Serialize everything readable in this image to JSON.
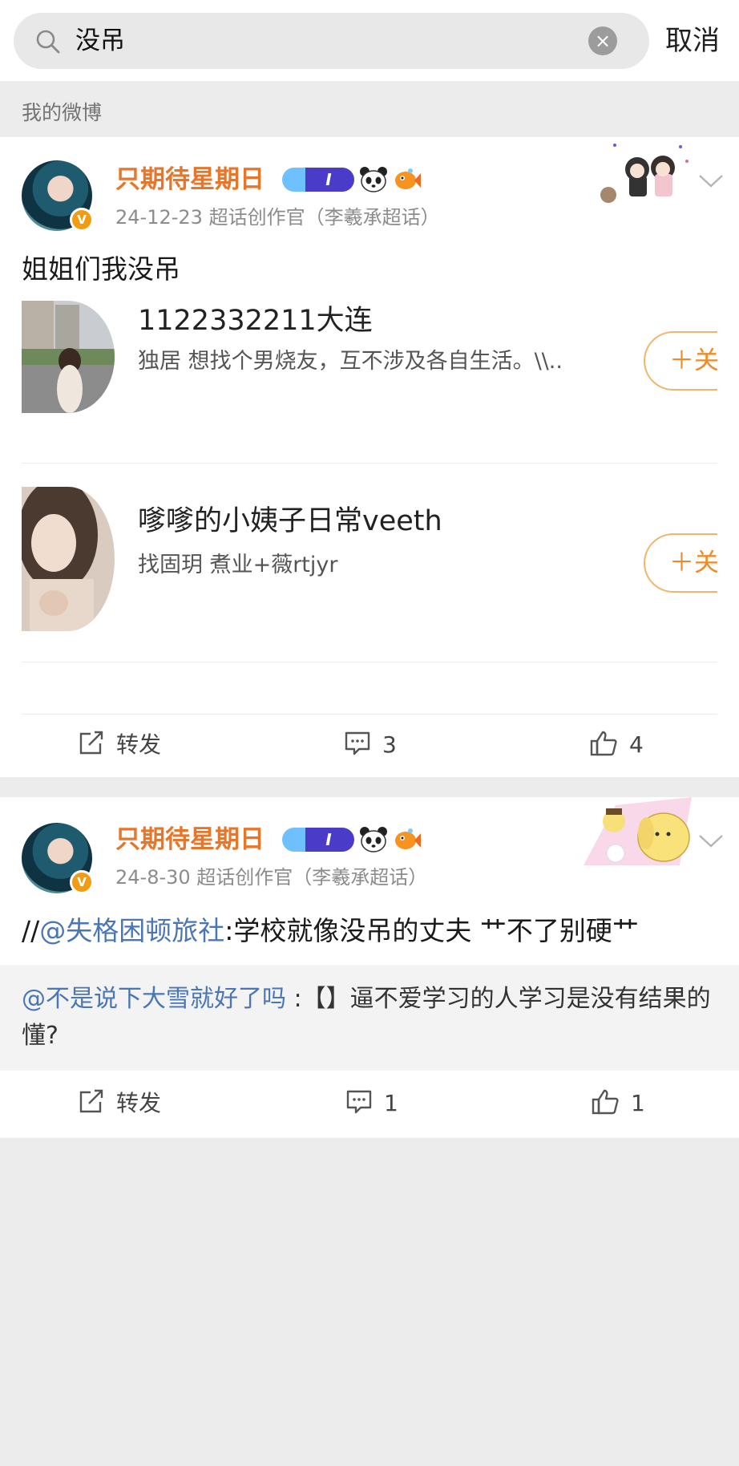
{
  "search": {
    "query": "没吊",
    "cancel_label": "取消"
  },
  "section_title": "我的微博",
  "posts": [
    {
      "username": "只期待星期日",
      "level_badge": "I",
      "meta": "24-12-23   超话创作官（李羲承超话）",
      "text": "姐姐们我没吊",
      "recommendations": [
        {
          "name": "1122332211大连",
          "desc": "独居 想找个男烧友，互不涉及各自生活。\\\\..",
          "follow_label": "＋关"
        },
        {
          "name": "嗲嗲的小姨子日常veeth",
          "desc": "找固玥 煮业+薇rtjyr",
          "follow_label": "＋关"
        }
      ],
      "actions": {
        "repost_label": "转发",
        "comment_count": "3",
        "like_count": "4"
      }
    },
    {
      "username": "只期待星期日",
      "level_badge": "I",
      "meta": "24-8-30   超话创作官（李羲承超话）",
      "text_prefix": "//",
      "mention": "@失格困顿旅社",
      "text_body": ":学校就像没吊的丈夫 艹不了别硬艹",
      "quote_mention": "@不是说下大雪就好了吗",
      "quote_text": " :【】逼不爱学习的人学习是没有结果的 懂?",
      "actions": {
        "repost_label": "转发",
        "comment_count": "1",
        "like_count": "1"
      }
    }
  ],
  "colors": {
    "accent_orange": "#e8762a",
    "link_blue": "#4a76b5",
    "follow_orange": "#f08a24",
    "page_bg": "#ececec"
  }
}
